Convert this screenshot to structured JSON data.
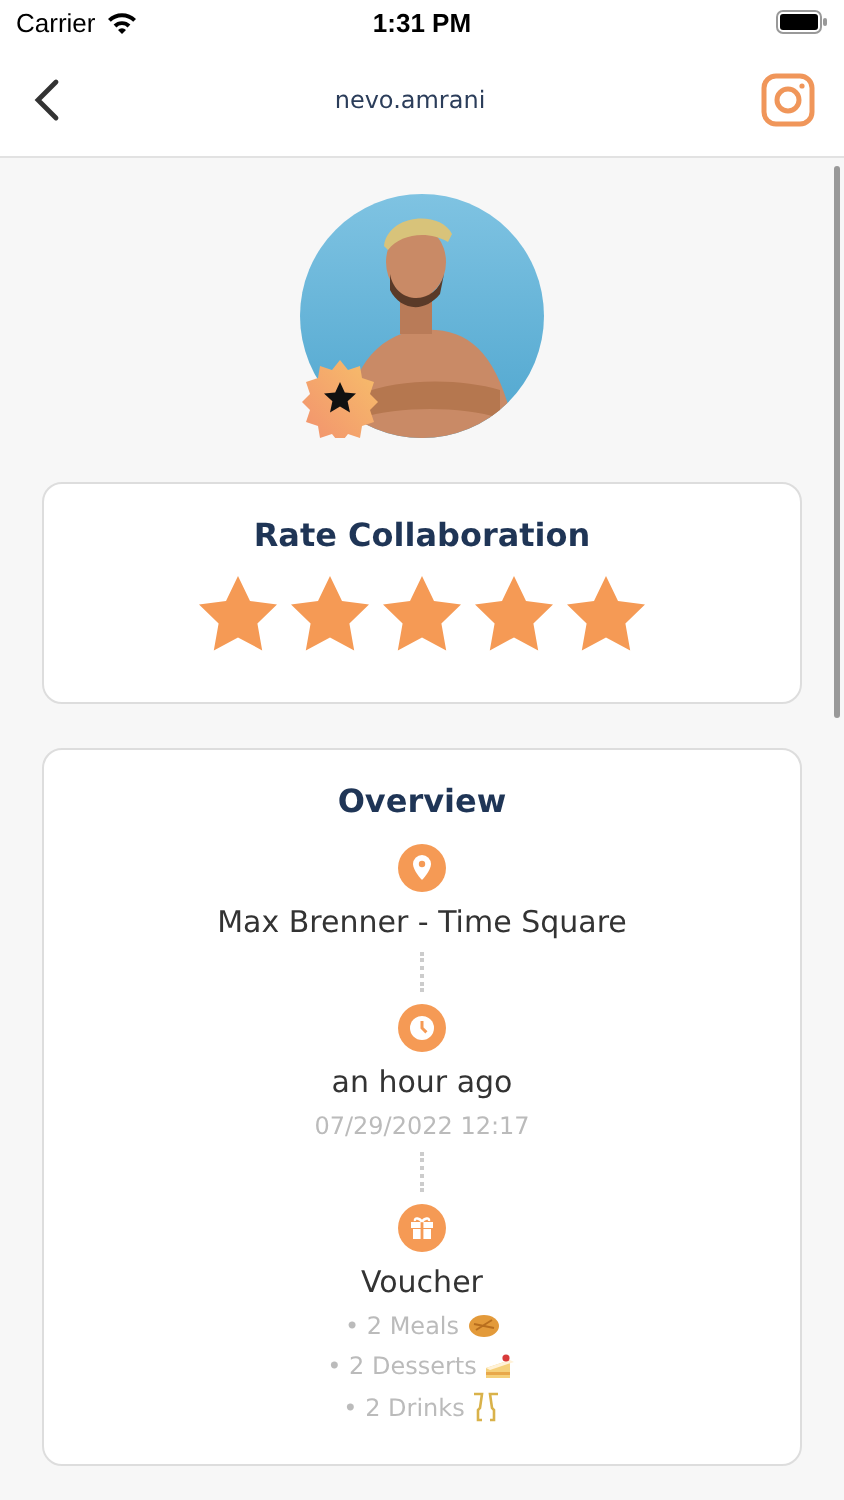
{
  "status_bar": {
    "carrier": "Carrier",
    "time": "1:31 PM"
  },
  "nav": {
    "title": "nevo.amrani"
  },
  "rating": {
    "title": "Rate Collaboration",
    "stars": 5
  },
  "overview": {
    "title": "Overview",
    "steps": [
      {
        "kind": "location",
        "title": "Max Brenner - Time Square"
      },
      {
        "kind": "time",
        "title": "an hour ago",
        "subtitle": "07/29/2022 12:17"
      },
      {
        "kind": "voucher",
        "title": "Voucher",
        "items": [
          {
            "text": "• 2 Meals",
            "kind": "pie"
          },
          {
            "text": "• 2 Desserts",
            "kind": "cake"
          },
          {
            "text": "• 2 Drinks",
            "kind": "glasses"
          }
        ]
      }
    ]
  }
}
